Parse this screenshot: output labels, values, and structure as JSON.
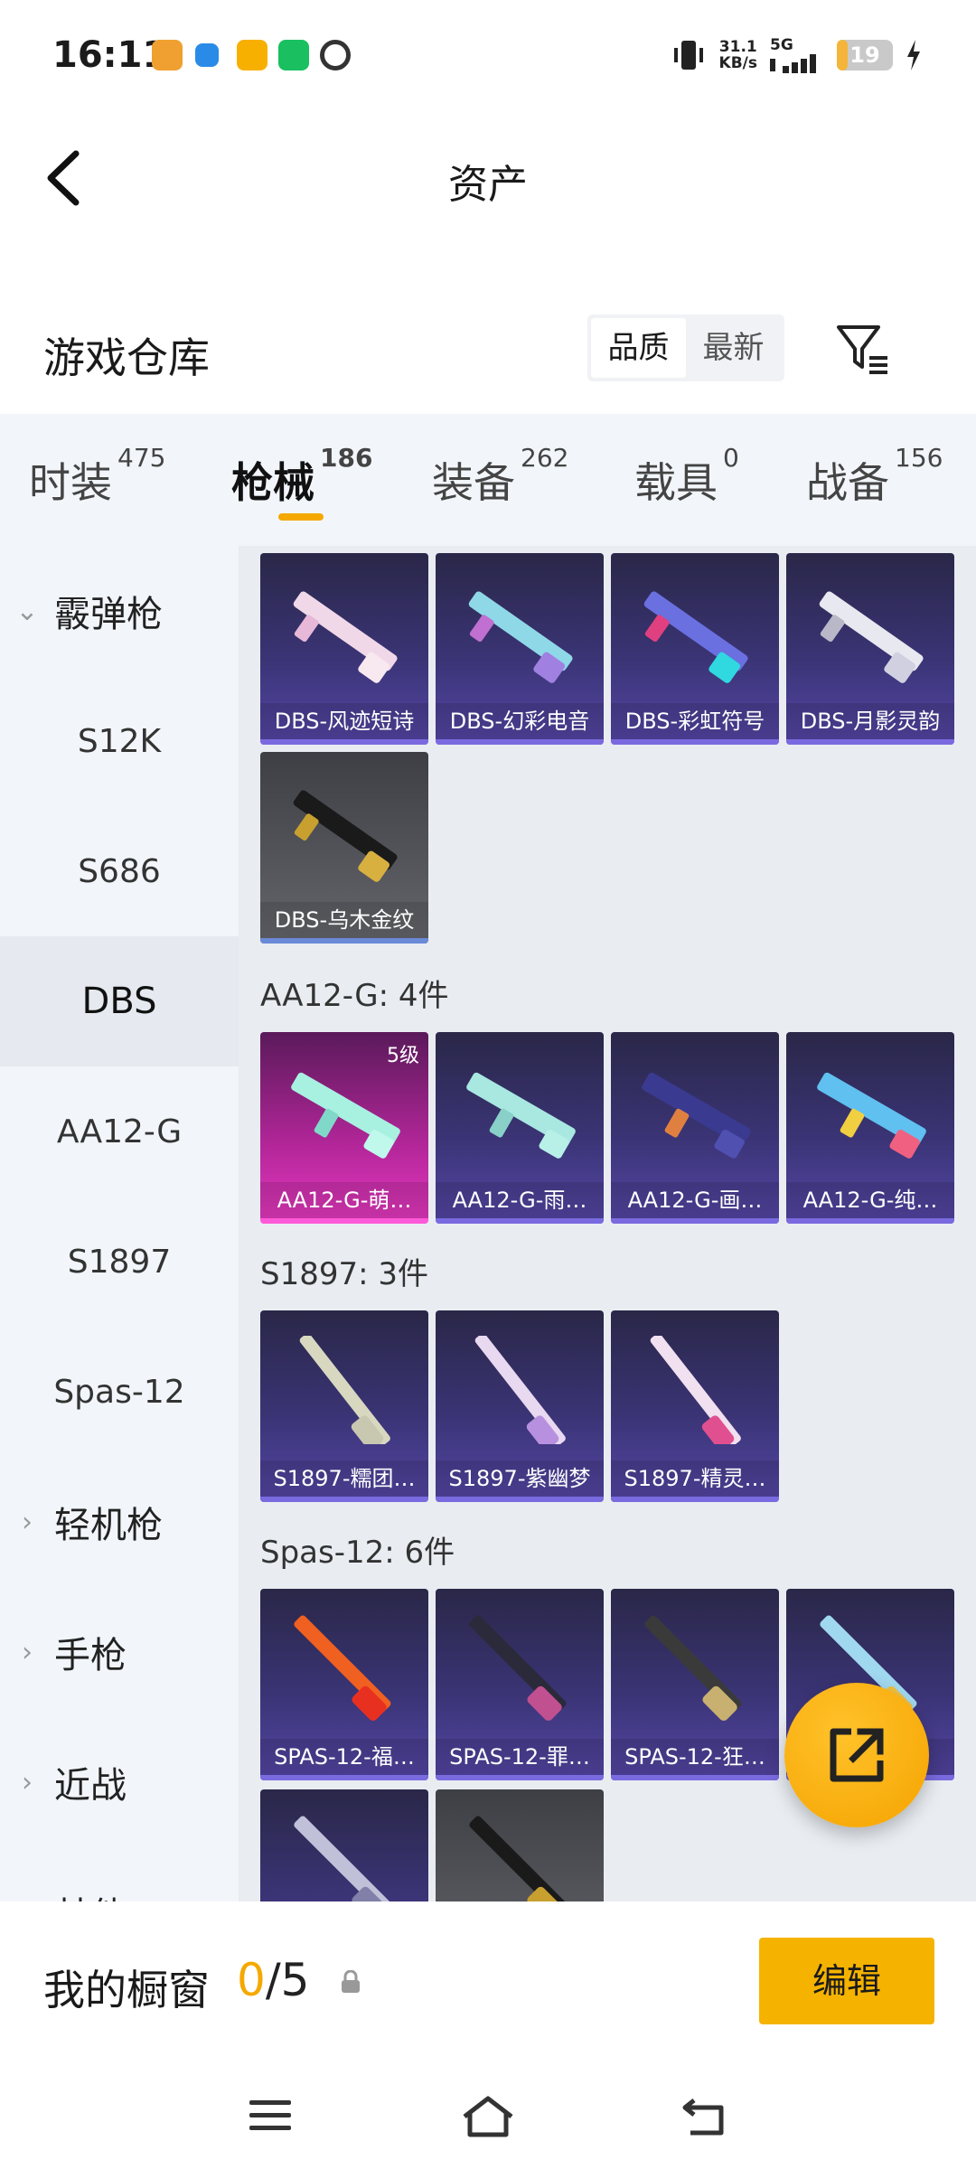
{
  "status_bar": {
    "time": "16:11",
    "net_speed": "31.1",
    "net_speed_unit": "KB/s",
    "network": "5G",
    "battery": "19",
    "battery_fraction": 0.19
  },
  "header": {
    "title": "资产"
  },
  "warehouse": {
    "title": "游戏仓库",
    "sort_options": [
      "品质",
      "最新"
    ],
    "active_sort": "品质"
  },
  "tabs": [
    {
      "label": "时装",
      "count": "475"
    },
    {
      "label": "枪械",
      "count": "186"
    },
    {
      "label": "装备",
      "count": "262"
    },
    {
      "label": "载具",
      "count": "0"
    },
    {
      "label": "战备",
      "count": "156"
    }
  ],
  "active_tab": "枪械",
  "sidenav": {
    "groups": [
      {
        "label": "霰弹枪",
        "expanded": true
      },
      {
        "label": "轻机枪",
        "expanded": false
      },
      {
        "label": "手枪",
        "expanded": false
      },
      {
        "label": "近战",
        "expanded": false
      },
      {
        "label": "其他",
        "expanded": false
      }
    ],
    "items": [
      "S12K",
      "S686",
      "DBS",
      "AA12-G",
      "S1897",
      "Spas-12"
    ],
    "active_item": "DBS"
  },
  "sections": [
    {
      "title": "",
      "cards": [
        {
          "label": "DBS-风迹短诗",
          "style": "purple"
        },
        {
          "label": "DBS-幻彩电音",
          "style": "purple"
        },
        {
          "label": "DBS-彩虹符号",
          "style": "purple"
        },
        {
          "label": "DBS-月影灵韵",
          "style": "purple"
        },
        {
          "label": "DBS-乌木金纹",
          "style": "gray"
        }
      ]
    },
    {
      "title": "AA12-G: 4件",
      "cards": [
        {
          "label": "AA12-G-萌…",
          "style": "pink",
          "level": "5级"
        },
        {
          "label": "AA12-G-雨…",
          "style": "purple"
        },
        {
          "label": "AA12-G-画…",
          "style": "purple"
        },
        {
          "label": "AA12-G-纯…",
          "style": "purple"
        }
      ]
    },
    {
      "title": "S1897: 3件",
      "cards": [
        {
          "label": "S1897-糯团…",
          "style": "purple"
        },
        {
          "label": "S1897-紫幽梦",
          "style": "purple"
        },
        {
          "label": "S1897-精灵…",
          "style": "purple"
        }
      ]
    },
    {
      "title": "Spas-12: 6件",
      "cards": [
        {
          "label": "SPAS-12-福…",
          "style": "purple"
        },
        {
          "label": "SPAS-12-罪…",
          "style": "purple"
        },
        {
          "label": "SPAS-12-狂…",
          "style": "purple"
        },
        {
          "label": "",
          "style": "purple"
        },
        {
          "label": "",
          "style": "purple"
        },
        {
          "label": "",
          "style": "gray"
        }
      ]
    }
  ],
  "showcase": {
    "title": "我的橱窗",
    "current": "0",
    "separator": "/",
    "max": "5",
    "edit_label": "编辑"
  },
  "colors": {
    "accent": "#f5a800",
    "card_purple": "#3a3475",
    "card_gray": "#55565c",
    "card_pink": "#b4269a",
    "panel_bg": "#f2f6fb"
  },
  "icons": [
    "back-arrow-icon",
    "filter-icon",
    "share-icon",
    "lock-icon",
    "menu-icon",
    "home-icon",
    "back-nav-icon"
  ]
}
